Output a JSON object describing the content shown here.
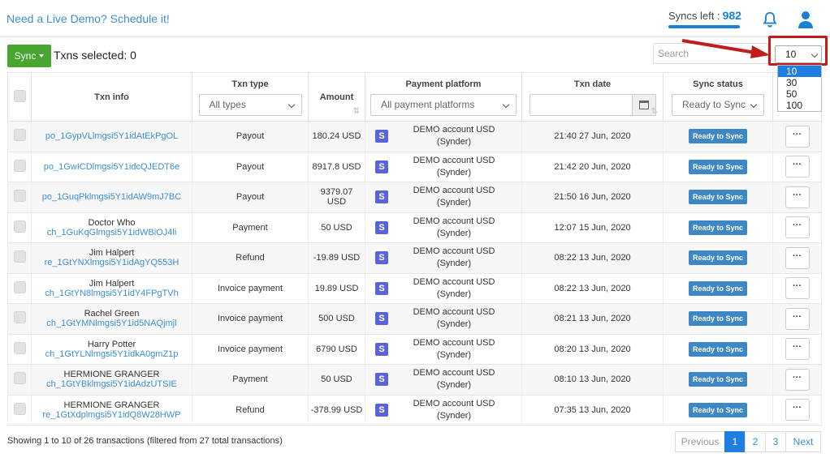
{
  "header": {
    "demo_link": "Need a Live Demo? Schedule it!",
    "syncs_label": "Syncs left :",
    "syncs_count": "982"
  },
  "toolbar": {
    "sync_label": "Sync",
    "txns_selected": "Txns selected: 0",
    "search_placeholder": "Search",
    "page_size": "10",
    "page_size_options": [
      "10",
      "30",
      "50",
      "100"
    ]
  },
  "table": {
    "headers": {
      "txn_info": "Txn info",
      "txn_type": "Txn type",
      "txn_type_filter": "All types",
      "amount": "Amount",
      "payment_platform": "Payment platform",
      "platform_filter": "All payment platforms",
      "txn_date": "Txn date",
      "sync_status": "Sync status",
      "status_filter": "Ready to Sync"
    },
    "rows": [
      {
        "customer": "",
        "txn_id": "po_1GypVLlmgsi5Y1idAtEkPgOL",
        "type": "Payout",
        "amount": "180.24 USD",
        "platform_line1": "DEMO account USD",
        "platform_line2": "(Synder)",
        "date": "21:40 27 Jun, 2020",
        "status": "Ready to Sync"
      },
      {
        "customer": "",
        "txn_id": "po_1GwICDlmgsi5Y1idcQJEDT6e",
        "type": "Payout",
        "amount": "8917.8 USD",
        "platform_line1": "DEMO account USD",
        "platform_line2": "(Synder)",
        "date": "21:42 20 Jun, 2020",
        "status": "Ready to Sync"
      },
      {
        "customer": "",
        "txn_id": "po_1GuqPklmgsi5Y1idAW9mJ7BC",
        "type": "Payout",
        "amount": "9379.07 USD",
        "platform_line1": "DEMO account USD",
        "platform_line2": "(Synder)",
        "date": "21:50 16 Jun, 2020",
        "status": "Ready to Sync"
      },
      {
        "customer": "Doctor Who",
        "txn_id": "ch_1GuKqGlmgsi5Y1idWBiOJ4li",
        "type": "Payment",
        "amount": "50 USD",
        "platform_line1": "DEMO account USD",
        "platform_line2": "(Synder)",
        "date": "12:07 15 Jun, 2020",
        "status": "Ready to Sync"
      },
      {
        "customer": "Jim Halpert",
        "txn_id": "re_1GtYNXlmgsi5Y1idAgYQ553H",
        "type": "Refund",
        "amount": "-19.89 USD",
        "platform_line1": "DEMO account USD",
        "platform_line2": "(Synder)",
        "date": "08:22 13 Jun, 2020",
        "status": "Ready to Sync"
      },
      {
        "customer": "Jim Halpert",
        "txn_id": "ch_1GtYN8lmgsi5Y1idY4FPgTVh",
        "type": "Invoice payment",
        "amount": "19.89 USD",
        "platform_line1": "DEMO account USD",
        "platform_line2": "(Synder)",
        "date": "08:22 13 Jun, 2020",
        "status": "Ready to Sync"
      },
      {
        "customer": "Rachel Green",
        "txn_id": "ch_1GtYMNlmgsi5Y1id5NAQjmjl",
        "type": "Invoice payment",
        "amount": "500 USD",
        "platform_line1": "DEMO account USD",
        "platform_line2": "(Synder)",
        "date": "08:21 13 Jun, 2020",
        "status": "Ready to Sync"
      },
      {
        "customer": "Harry Potter",
        "txn_id": "ch_1GtYLNlmgsi5Y1idkA0gmZ1p",
        "type": "Invoice payment",
        "amount": "6790 USD",
        "platform_line1": "DEMO account USD",
        "platform_line2": "(Synder)",
        "date": "08:20 13 Jun, 2020",
        "status": "Ready to Sync"
      },
      {
        "customer": "HERMIONE GRANGER",
        "txn_id": "ch_1GtYBklmgsi5Y1idAdzUTSIE",
        "type": "Payment",
        "amount": "50 USD",
        "platform_line1": "DEMO account USD",
        "platform_line2": "(Synder)",
        "date": "08:10 13 Jun, 2020",
        "status": "Ready to Sync"
      },
      {
        "customer": "HERMIONE GRANGER",
        "txn_id": "re_1GtXdplmgsi5Y1idQ8W28HWP",
        "type": "Refund",
        "amount": "-378.99 USD",
        "platform_line1": "DEMO account USD",
        "platform_line2": "(Synder)",
        "date": "07:35 13 Jun, 2020",
        "status": "Ready to Sync"
      }
    ],
    "more_label": "···",
    "platform_logo": "S"
  },
  "footer": {
    "showing": "Showing 1 to 10 of 26 transactions (filtered from 27 total transactions)",
    "prev": "Previous",
    "pages": [
      "1",
      "2",
      "3"
    ],
    "next": "Next"
  },
  "colors": {
    "accent": "#1e7fe0",
    "sync_button": "#47a530",
    "status_badge": "#3d87c5",
    "highlight": "#c21d1d"
  }
}
